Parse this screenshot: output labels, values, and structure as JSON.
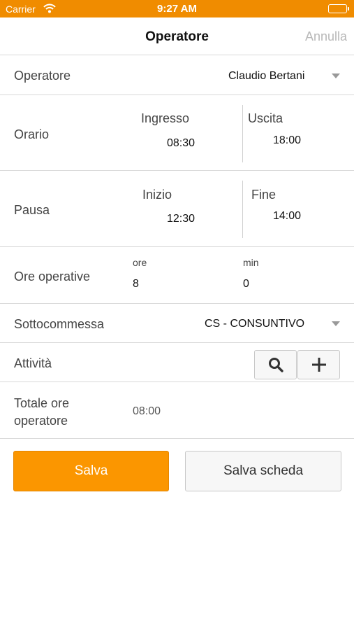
{
  "status_bar": {
    "carrier": "Carrier",
    "time": "9:27 AM"
  },
  "nav": {
    "title": "Operatore",
    "cancel_label": "Annulla"
  },
  "operatore": {
    "label": "Operatore",
    "value": "Claudio Bertani"
  },
  "orario": {
    "label": "Orario",
    "in_caption": "Ingresso",
    "in_value": "08:30",
    "out_caption": "Uscita",
    "out_value": "18:00"
  },
  "pausa": {
    "label": "Pausa",
    "start_caption": "Inizio",
    "start_value": "12:30",
    "end_caption": "Fine",
    "end_value": "14:00"
  },
  "ore_operative": {
    "label": "Ore operative",
    "hours_caption": "ore",
    "hours_value": "8",
    "minutes_caption": "min",
    "minutes_value": "0"
  },
  "sottocommessa": {
    "label": "Sottocommessa",
    "value": "CS - CONSUNTIVO"
  },
  "attivita": {
    "label": "Attività",
    "search_icon": "search-icon",
    "add_icon": "plus-icon"
  },
  "totale": {
    "label_line1": "Totale ore",
    "label_line2": "operatore",
    "value": "08:00"
  },
  "actions": {
    "save_label": "Salva",
    "save_sheet_label": "Salva scheda"
  },
  "colors": {
    "accent": "#fb9600",
    "status_bar": "#f08c00"
  }
}
